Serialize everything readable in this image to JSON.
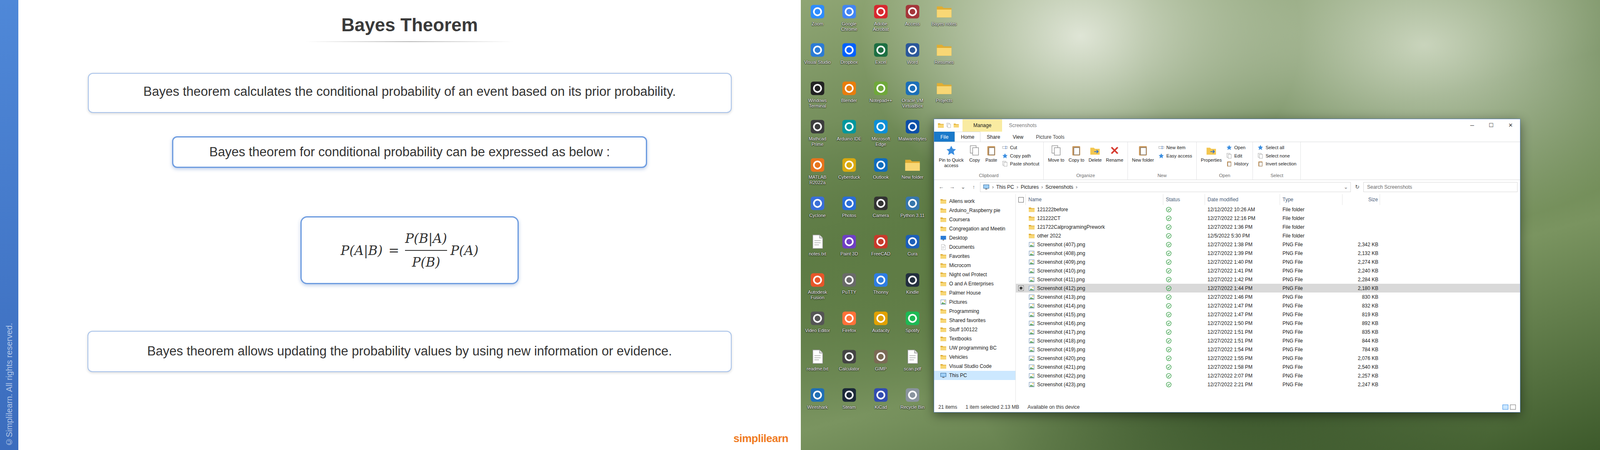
{
  "slide": {
    "title": "Bayes Theorem",
    "copyright": "©Simplilearn. All rights reserved.",
    "definition": "Bayes theorem calculates the conditional probability of an event based on its prior probability.",
    "intro": "Bayes theorem for conditional probability can be expressed as below :",
    "formula": {
      "lhs": "P(A|B)",
      "equals": "=",
      "numerator": "P(B|A)",
      "denominator": "P(B)",
      "factor": "P(A)"
    },
    "note": "Bayes theorem allows updating the probability values by using new information or evidence.",
    "logo": "simplilearn"
  },
  "desktop": {
    "icons": [
      {
        "label": "Zoom",
        "kind": "app",
        "color": "#2d8cff"
      },
      {
        "label": "Visual Studio",
        "kind": "app",
        "color": "#2b7bd6"
      },
      {
        "label": "Windows Terminal",
        "kind": "app",
        "color": "#222222"
      },
      {
        "label": "Mathcad Prime",
        "kind": "app",
        "color": "#3c3c3c"
      },
      {
        "label": "MATLAB R2022a",
        "kind": "app",
        "color": "#e8741c"
      },
      {
        "label": "Cyclone",
        "kind": "app",
        "color": "#3a6fd8"
      },
      {
        "label": "notes.txt",
        "kind": "doc"
      },
      {
        "label": "Autodesk Fusion",
        "kind": "app",
        "color": "#e8562a"
      },
      {
        "label": "Video Editor",
        "kind": "app",
        "color": "#555555"
      },
      {
        "label": "readme.txt",
        "kind": "doc"
      },
      {
        "label": "Wireshark",
        "kind": "app",
        "color": "#1f6fb5"
      },
      {
        "label": "Google Chrome",
        "kind": "app",
        "color": "#4285f4"
      },
      {
        "label": "Dropbox",
        "kind": "app",
        "color": "#0061ff"
      },
      {
        "label": "Blender",
        "kind": "app",
        "color": "#e87d0d"
      },
      {
        "label": "Arduino IDE",
        "kind": "app",
        "color": "#00979d"
      },
      {
        "label": "Cyberduck",
        "kind": "app",
        "color": "#d9a90f"
      },
      {
        "label": "Photos",
        "kind": "app",
        "color": "#2a6dd6"
      },
      {
        "label": "Paint 3D",
        "kind": "app",
        "color": "#6f3fc4"
      },
      {
        "label": "PuTTY",
        "kind": "app",
        "color": "#6a6a6a"
      },
      {
        "label": "Firefox",
        "kind": "app",
        "color": "#ff7139"
      },
      {
        "label": "Calculator",
        "kind": "app",
        "color": "#444444"
      },
      {
        "label": "Steam",
        "kind": "app",
        "color": "#1b2838"
      },
      {
        "label": "Adobe Acrobat",
        "kind": "app",
        "color": "#d7282f"
      },
      {
        "label": "Excel",
        "kind": "app",
        "color": "#1d6f42"
      },
      {
        "label": "Notepad++",
        "kind": "app",
        "color": "#6fa83a"
      },
      {
        "label": "Microsoft Edge",
        "kind": "app",
        "color": "#0c8fd6"
      },
      {
        "label": "Outlook",
        "kind": "app",
        "color": "#0f6cbd"
      },
      {
        "label": "Camera",
        "kind": "app",
        "color": "#333333"
      },
      {
        "label": "FreeCAD",
        "kind": "app",
        "color": "#c73a2b"
      },
      {
        "label": "Thonny",
        "kind": "app",
        "color": "#2f7de1"
      },
      {
        "label": "Audacity",
        "kind": "app",
        "color": "#e0a100"
      },
      {
        "label": "GIMP",
        "kind": "app",
        "color": "#7a6a55"
      },
      {
        "label": "KiCad",
        "kind": "app",
        "color": "#314cb0"
      },
      {
        "label": "Access",
        "kind": "app",
        "color": "#a4373a"
      },
      {
        "label": "Word",
        "kind": "app",
        "color": "#2b579a"
      },
      {
        "label": "Oracle VM VirtualBox",
        "kind": "app",
        "color": "#1b6fb8"
      },
      {
        "label": "Malwarebytes",
        "kind": "app",
        "color": "#0d4fa8"
      },
      {
        "label": "New folder",
        "kind": "folder"
      },
      {
        "label": "Python 3.11",
        "kind": "app",
        "color": "#3776ab"
      },
      {
        "label": "Cura",
        "kind": "app",
        "color": "#1d5fb8"
      },
      {
        "label": "Kindle",
        "kind": "app",
        "color": "#232f3e"
      },
      {
        "label": "Spotify",
        "kind": "app",
        "color": "#1db954"
      },
      {
        "label": "scan.pdf",
        "kind": "doc"
      },
      {
        "label": "Recycle Bin",
        "kind": "app",
        "color": "#8a949e"
      },
      {
        "label": "Bayes notes",
        "kind": "folder"
      },
      {
        "label": "Resumes",
        "kind": "folder"
      },
      {
        "label": "Projects",
        "kind": "folder"
      }
    ]
  },
  "explorer": {
    "context_tab": "Manage",
    "title": "Screenshots",
    "controls": [
      "─",
      "☐",
      "✕"
    ],
    "tabs": [
      {
        "label": "File",
        "selected": false,
        "kind": "file"
      },
      {
        "label": "Home",
        "selected": true,
        "kind": "tab"
      },
      {
        "label": "Share",
        "selected": false,
        "kind": "tab"
      },
      {
        "label": "View",
        "selected": false,
        "kind": "tab"
      },
      {
        "label": "Picture Tools",
        "selected": false,
        "kind": "context"
      }
    ],
    "ribbon": [
      {
        "name": "Clipboard",
        "buttons": [
          {
            "label": "Pin to Quick access",
            "kind": "large"
          },
          {
            "label": "Copy",
            "kind": "large"
          },
          {
            "label": "Paste",
            "kind": "large"
          },
          {
            "label": "Cut",
            "kind": "small"
          },
          {
            "label": "Copy path",
            "kind": "small"
          },
          {
            "label": "Paste shortcut",
            "kind": "small"
          }
        ]
      },
      {
        "name": "Organize",
        "buttons": [
          {
            "label": "Move to",
            "kind": "large"
          },
          {
            "label": "Copy to",
            "kind": "large"
          },
          {
            "label": "Delete",
            "kind": "large"
          },
          {
            "label": "Rename",
            "kind": "large"
          }
        ]
      },
      {
        "name": "New",
        "buttons": [
          {
            "label": "New folder",
            "kind": "large"
          },
          {
            "label": "New item",
            "kind": "small"
          },
          {
            "label": "Easy access",
            "kind": "small"
          }
        ]
      },
      {
        "name": "Open",
        "buttons": [
          {
            "label": "Properties",
            "kind": "large"
          },
          {
            "label": "Open",
            "kind": "small"
          },
          {
            "label": "Edit",
            "kind": "small"
          },
          {
            "label": "History",
            "kind": "small"
          }
        ]
      },
      {
        "name": "Select",
        "buttons": [
          {
            "label": "Select all",
            "kind": "small"
          },
          {
            "label": "Select none",
            "kind": "small"
          },
          {
            "label": "Invert selection",
            "kind": "small"
          }
        ]
      }
    ],
    "nav_buttons": [
      "←",
      "→",
      "⌄",
      "↑"
    ],
    "address": [
      "This PC",
      "Pictures",
      "Screenshots"
    ],
    "separator": "›",
    "dropdown": "⌄",
    "refresh": "↻",
    "search_placeholder": "Search Screenshots",
    "sidebar": [
      {
        "label": "Allens work",
        "kind": "folder",
        "selected": false
      },
      {
        "label": "Arduino_Raspberry pie",
        "kind": "folder",
        "selected": false
      },
      {
        "label": "Coursera",
        "kind": "folder",
        "selected": false
      },
      {
        "label": "Congregation and Meetin",
        "kind": "folder",
        "selected": false
      },
      {
        "label": "Desktop",
        "kind": "desktop",
        "selected": false
      },
      {
        "label": "Documents",
        "kind": "documents",
        "selected": false
      },
      {
        "label": "Favorites",
        "kind": "folder",
        "selected": false
      },
      {
        "label": "Microcom",
        "kind": "folder",
        "selected": false
      },
      {
        "label": "Night owl Protect",
        "kind": "folder",
        "selected": false
      },
      {
        "label": "O and A Enterprises",
        "kind": "folder",
        "selected": false
      },
      {
        "label": "Palmer House",
        "kind": "folder",
        "selected": false
      },
      {
        "label": "Pictures",
        "kind": "pictures",
        "selected": false
      },
      {
        "label": "Programming",
        "kind": "folder",
        "selected": false
      },
      {
        "label": "Shared favorites",
        "kind": "folder",
        "selected": false
      },
      {
        "label": "Stuff 100122",
        "kind": "folder",
        "selected": false
      },
      {
        "label": "Textbooks",
        "kind": "folder",
        "selected": false
      },
      {
        "label": "UW programming BC",
        "kind": "folder",
        "selected": false
      },
      {
        "label": "Vehicles",
        "kind": "folder",
        "selected": false
      },
      {
        "label": "Visual Studio Code",
        "kind": "folder",
        "selected": false
      },
      {
        "label": "This PC",
        "kind": "pc",
        "selected": true
      }
    ],
    "columns": [
      "Name",
      "Status",
      "Date modified",
      "Type",
      "Size"
    ],
    "rows": [
      {
        "name": "121222before",
        "date": "12/12/2022 10:26 AM",
        "type": "File folder",
        "kind": "folder",
        "synced": true,
        "selected": false
      },
      {
        "name": "121222CT",
        "date": "12/27/2022 12:16 PM",
        "type": "File folder",
        "kind": "folder",
        "synced": true,
        "selected": false
      },
      {
        "name": "121722CalprogramingPrework",
        "date": "12/27/2022 1:36 PM",
        "type": "File folder",
        "kind": "folder",
        "synced": true,
        "selected": false
      },
      {
        "name": "other 2022",
        "date": "12/5/2022 5:30 PM",
        "type": "File folder",
        "kind": "folder",
        "synced": true,
        "selected": false
      },
      {
        "name": "Screenshot (407).png",
        "date": "12/27/2022 1:38 PM",
        "type": "PNG File",
        "size": "2,342 KB",
        "kind": "png",
        "synced": true,
        "selected": false
      },
      {
        "name": "Screenshot (408).png",
        "date": "12/27/2022 1:39 PM",
        "type": "PNG File",
        "size": "2,132 KB",
        "kind": "png",
        "synced": true,
        "selected": false
      },
      {
        "name": "Screenshot (409).png",
        "date": "12/27/2022 1:40 PM",
        "type": "PNG File",
        "size": "2,274 KB",
        "kind": "png",
        "synced": true,
        "selected": false
      },
      {
        "name": "Screenshot (410).png",
        "date": "12/27/2022 1:41 PM",
        "type": "PNG File",
        "size": "2,240 KB",
        "kind": "png",
        "synced": true,
        "selected": false
      },
      {
        "name": "Screenshot (411).png",
        "date": "12/27/2022 1:42 PM",
        "type": "PNG File",
        "size": "2,284 KB",
        "kind": "png",
        "synced": true,
        "selected": false
      },
      {
        "name": "Screenshot (412).png",
        "date": "12/27/2022 1:44 PM",
        "type": "PNG File",
        "size": "2,180 KB",
        "kind": "png",
        "synced": true,
        "selected": true
      },
      {
        "name": "Screenshot (413).png",
        "date": "12/27/2022 1:46 PM",
        "type": "PNG File",
        "size": "830 KB",
        "kind": "png",
        "synced": true,
        "selected": false
      },
      {
        "name": "Screenshot (414).png",
        "date": "12/27/2022 1:47 PM",
        "type": "PNG File",
        "size": "832 KB",
        "kind": "png",
        "synced": true,
        "selected": false
      },
      {
        "name": "Screenshot (415).png",
        "date": "12/27/2022 1:47 PM",
        "type": "PNG File",
        "size": "819 KB",
        "kind": "png",
        "synced": true,
        "selected": false
      },
      {
        "name": "Screenshot (416).png",
        "date": "12/27/2022 1:50 PM",
        "type": "PNG File",
        "size": "892 KB",
        "kind": "png",
        "synced": true,
        "selected": false
      },
      {
        "name": "Screenshot (417).png",
        "date": "12/27/2022 1:51 PM",
        "type": "PNG File",
        "size": "835 KB",
        "kind": "png",
        "synced": true,
        "selected": false
      },
      {
        "name": "Screenshot (418).png",
        "date": "12/27/2022 1:51 PM",
        "type": "PNG File",
        "size": "844 KB",
        "kind": "png",
        "synced": true,
        "selected": false
      },
      {
        "name": "Screenshot (419).png",
        "date": "12/27/2022 1:54 PM",
        "type": "PNG File",
        "size": "784 KB",
        "kind": "png",
        "synced": true,
        "selected": false
      },
      {
        "name": "Screenshot (420).png",
        "date": "12/27/2022 1:55 PM",
        "type": "PNG File",
        "size": "2,076 KB",
        "kind": "png",
        "synced": true,
        "selected": false
      },
      {
        "name": "Screenshot (421).png",
        "date": "12/27/2022 1:58 PM",
        "type": "PNG File",
        "size": "2,540 KB",
        "kind": "png",
        "synced": true,
        "selected": false
      },
      {
        "name": "Screenshot (422).png",
        "date": "12/27/2022 2:07 PM",
        "type": "PNG File",
        "size": "2,257 KB",
        "kind": "png",
        "synced": true,
        "selected": false
      },
      {
        "name": "Screenshot (423).png",
        "date": "12/27/2022 2:21 PM",
        "type": "PNG File",
        "size": "2,247 KB",
        "kind": "png",
        "synced": true,
        "selected": false
      }
    ],
    "status_bar": {
      "count": "21 items",
      "selection": "1 item selected  2.13 MB",
      "availability": "Available on this device"
    }
  }
}
